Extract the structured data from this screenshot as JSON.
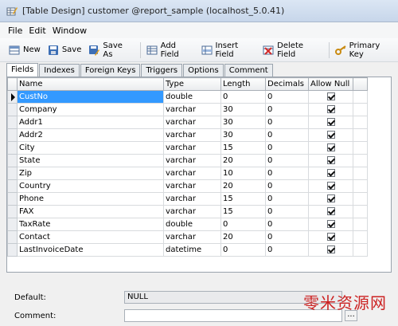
{
  "window": {
    "title": "[Table Design] customer @report_sample (localhost_5.0.41)"
  },
  "menu": [
    "File",
    "Edit",
    "Window"
  ],
  "toolbar": {
    "new_label": "New",
    "save_label": "Save",
    "saveas_label": "Save As",
    "addfield_label": "Add Field",
    "insertfield_label": "Insert Field",
    "deletefield_label": "Delete Field",
    "primarykey_label": "Primary Key"
  },
  "tabs": [
    "Fields",
    "Indexes",
    "Foreign Keys",
    "Triggers",
    "Options",
    "Comment"
  ],
  "grid": {
    "columns": [
      "Name",
      "Type",
      "Length",
      "Decimals",
      "Allow Null"
    ],
    "rows": [
      {
        "name": "CustNo",
        "type": "double",
        "length": "0",
        "decimals": "0",
        "allow_null": true
      },
      {
        "name": "Company",
        "type": "varchar",
        "length": "30",
        "decimals": "0",
        "allow_null": true
      },
      {
        "name": "Addr1",
        "type": "varchar",
        "length": "30",
        "decimals": "0",
        "allow_null": true
      },
      {
        "name": "Addr2",
        "type": "varchar",
        "length": "30",
        "decimals": "0",
        "allow_null": true
      },
      {
        "name": "City",
        "type": "varchar",
        "length": "15",
        "decimals": "0",
        "allow_null": true
      },
      {
        "name": "State",
        "type": "varchar",
        "length": "20",
        "decimals": "0",
        "allow_null": true
      },
      {
        "name": "Zip",
        "type": "varchar",
        "length": "10",
        "decimals": "0",
        "allow_null": true
      },
      {
        "name": "Country",
        "type": "varchar",
        "length": "20",
        "decimals": "0",
        "allow_null": true
      },
      {
        "name": "Phone",
        "type": "varchar",
        "length": "15",
        "decimals": "0",
        "allow_null": true
      },
      {
        "name": "FAX",
        "type": "varchar",
        "length": "15",
        "decimals": "0",
        "allow_null": true
      },
      {
        "name": "TaxRate",
        "type": "double",
        "length": "0",
        "decimals": "0",
        "allow_null": true
      },
      {
        "name": "Contact",
        "type": "varchar",
        "length": "20",
        "decimals": "0",
        "allow_null": true
      },
      {
        "name": "LastInvoiceDate",
        "type": "datetime",
        "length": "0",
        "decimals": "0",
        "allow_null": true
      }
    ],
    "selected_row": 0
  },
  "properties": {
    "default_label": "Default:",
    "default_value": "NULL",
    "comment_label": "Comment:",
    "comment_value": "",
    "ellipsis": "..."
  },
  "watermark": "零米资源网"
}
